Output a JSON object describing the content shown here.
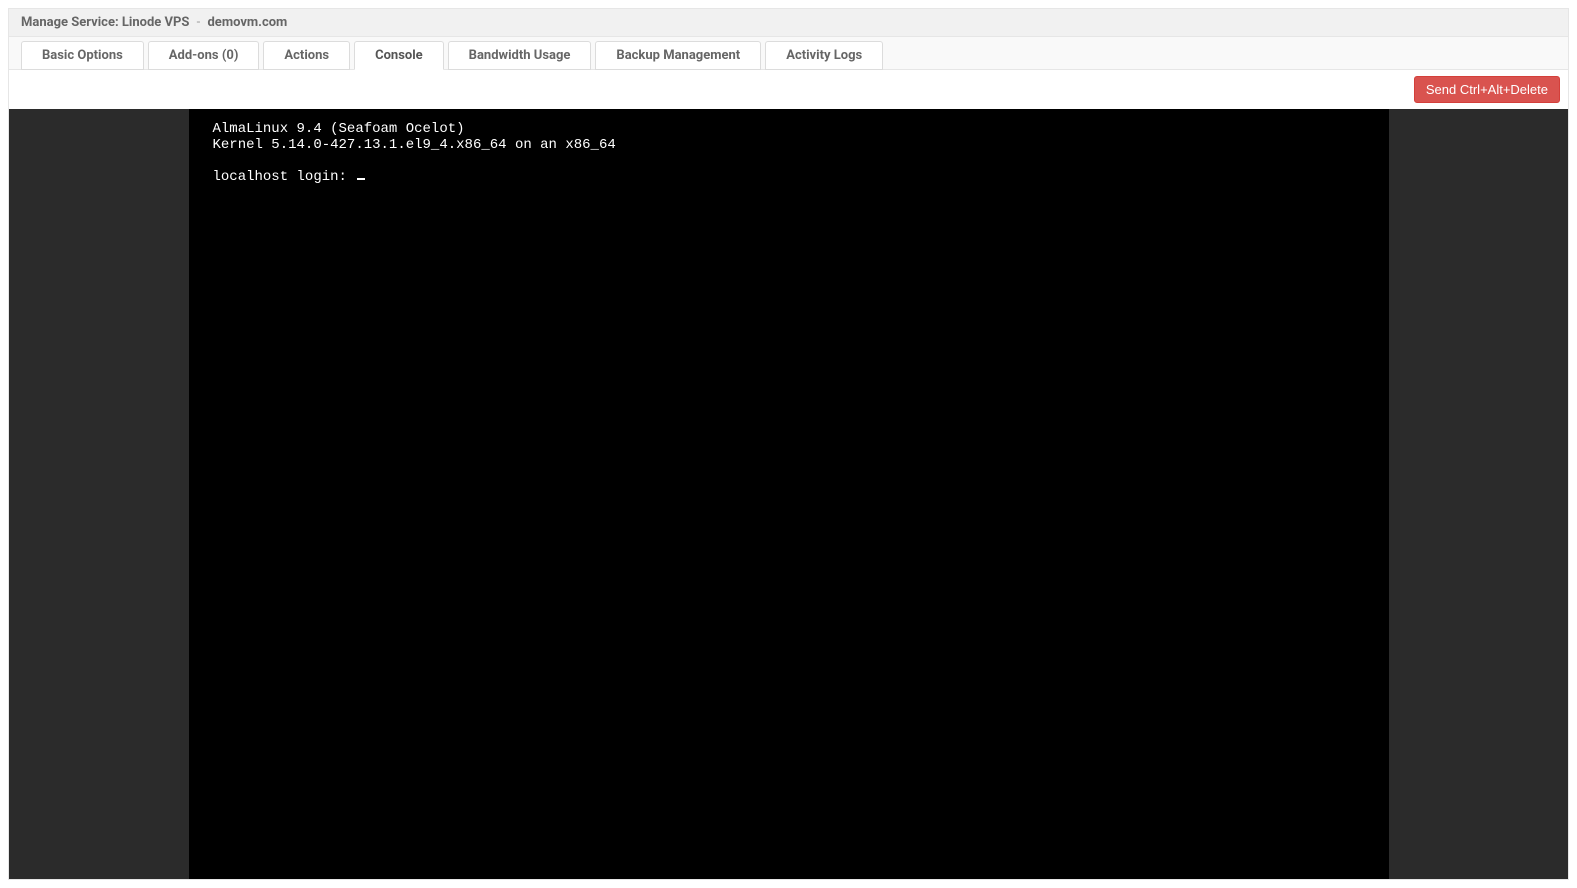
{
  "header": {
    "title_label": "Manage Service:",
    "service_name": "Linode VPS",
    "separator": "-",
    "domain": "demovm.com"
  },
  "tabs": [
    {
      "label": "Basic Options",
      "active": false
    },
    {
      "label": "Add-ons (0)",
      "active": false
    },
    {
      "label": "Actions",
      "active": false
    },
    {
      "label": "Console",
      "active": true
    },
    {
      "label": "Bandwidth Usage",
      "active": false
    },
    {
      "label": "Backup Management",
      "active": false
    },
    {
      "label": "Activity Logs",
      "active": false
    }
  ],
  "actions": {
    "send_cad_label": "Send Ctrl+Alt+Delete"
  },
  "console": {
    "line1": "AlmaLinux 9.4 (Seafoam Ocelot)",
    "line2": "Kernel 5.14.0-427.13.1.el9_4.x86_64 on an x86_64",
    "blank": "",
    "login_prompt": "localhost login: "
  }
}
